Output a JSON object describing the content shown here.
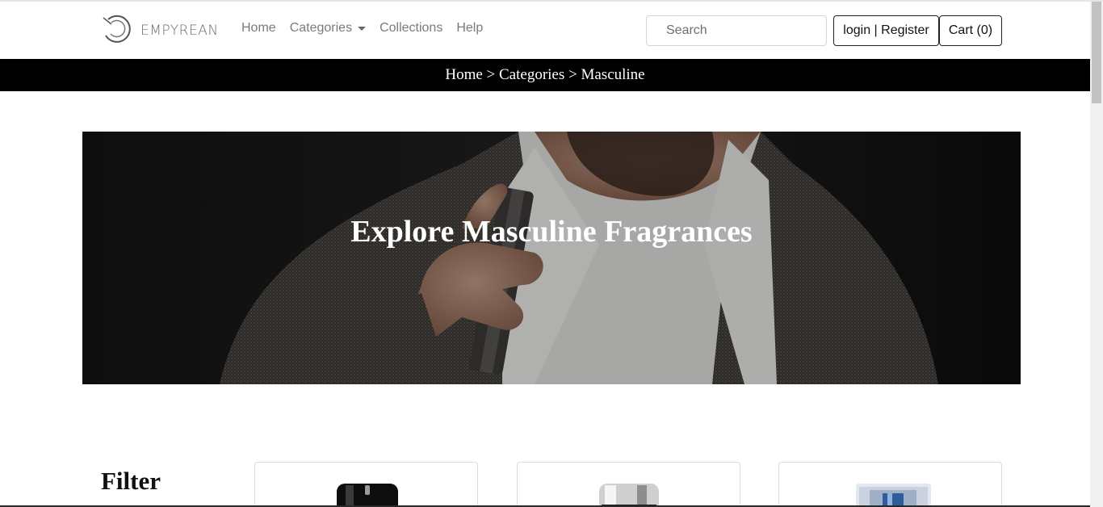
{
  "brand": {
    "name": "EMPYREAN",
    "logo_icon": "circle-swirl-logo"
  },
  "nav": {
    "items": [
      {
        "label": "Home"
      },
      {
        "label": "Categories",
        "dropdown": true
      },
      {
        "label": "Collections"
      },
      {
        "label": "Help"
      }
    ]
  },
  "search": {
    "placeholder": "Search",
    "value": ""
  },
  "account": {
    "login_label": "login | Register"
  },
  "cart": {
    "label": "Cart (0)"
  },
  "breadcrumb": {
    "text": "Home > Categories > Masculine"
  },
  "hero": {
    "title": "Explore Masculine Fragrances",
    "image": "man-spraying-perfume-photo"
  },
  "filter": {
    "title": "Filter"
  },
  "products": [
    {
      "image": "black-cap-perfume-bottle"
    },
    {
      "image": "silver-cap-perfume-bottle"
    },
    {
      "image": "blue-glass-perfume-bottle"
    }
  ],
  "colors": {
    "breadcrumb_bg": "#000000",
    "text_muted": "#7a7a7a"
  }
}
